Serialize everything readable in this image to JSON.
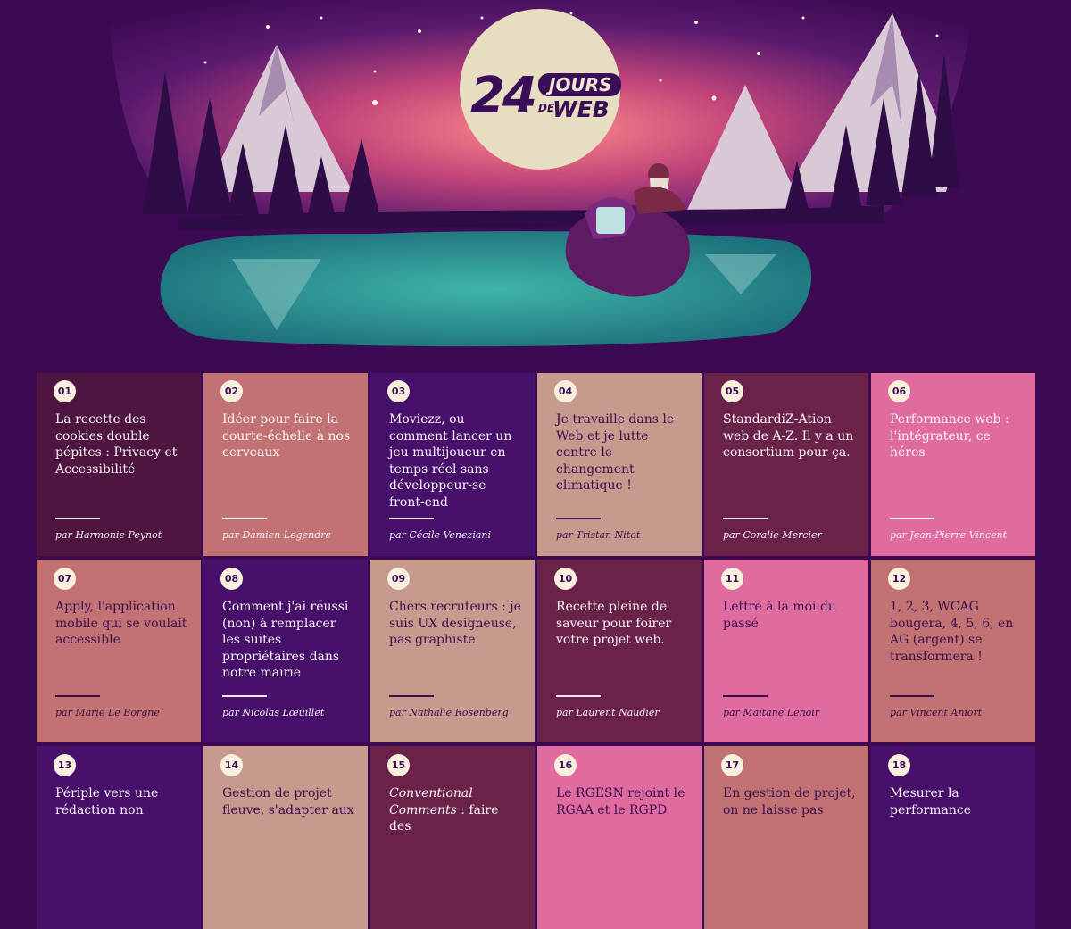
{
  "logo": {
    "number": "24",
    "jours": "JOURS",
    "de": "DE",
    "web": "WEB"
  },
  "cards": [
    {
      "num": "01",
      "title": "La recette des cookies double pépites : Privacy et Accessibilité",
      "author": "par Harmonie Peynot",
      "color": "#4e1540",
      "dark": false
    },
    {
      "num": "02",
      "title": "Idéer pour faire la courte-échelle à nos cerveaux",
      "author": "par Damien Legendre",
      "color": "#c27272",
      "dark": false
    },
    {
      "num": "03",
      "title": "Moviezz, ou comment lancer un jeu multijoueur en temps réel sans développeur-se front-end",
      "author": "par Cécile Veneziani",
      "color": "#46106b",
      "dark": false
    },
    {
      "num": "04",
      "title": "Je travaille dans le Web et je lutte contre le changement climatique !",
      "author": "par Tristan Nitot",
      "color": "#c79a8d",
      "dark": true
    },
    {
      "num": "05",
      "title": "StandardiZ-Ation web de A-Z. Il y a un consortium pour ça.",
      "author": "par Coralie Mercier",
      "color": "#6a2249",
      "dark": false
    },
    {
      "num": "06",
      "title": "Performance web : l'intégrateur, ce héros",
      "author": "par Jean-Pierre Vincent",
      "color": "#e06b9f",
      "dark": false
    },
    {
      "num": "07",
      "title": "Apply, l'application mobile qui se voulait accessible",
      "author": "par Marie Le Borgne",
      "color": "#c27272",
      "dark": true
    },
    {
      "num": "08",
      "title": "Comment j'ai réussi (non) à remplacer les suites propriétaires dans notre mairie",
      "author": "par Nicolas Lœuillet",
      "color": "#46106b",
      "dark": false
    },
    {
      "num": "09",
      "title": "Chers recruteurs : je suis UX designeuse, pas graphiste",
      "author": "par Nathalie Rosenberg",
      "color": "#c79a8d",
      "dark": true
    },
    {
      "num": "10",
      "title": "Recette pleine de saveur pour foirer votre projet web.",
      "author": "par Laurent Naudier",
      "color": "#6a2249",
      "dark": false
    },
    {
      "num": "11",
      "title": "Lettre à la moi du passé",
      "author": "par Maïtané Lenoir",
      "color": "#e06b9f",
      "dark": true
    },
    {
      "num": "12",
      "title": "1, 2, 3, WCAG bougera, 4, 5, 6, en AG (argent) se transformera !",
      "author": "par Vincent Aniort",
      "color": "#c27272",
      "dark": true
    },
    {
      "num": "13",
      "title": "Périple vers une rédaction non",
      "author": "",
      "color": "#46106b",
      "dark": false
    },
    {
      "num": "14",
      "title": "Gestion de projet fleuve, s'adapter aux",
      "author": "",
      "color": "#c79a8d",
      "dark": true
    },
    {
      "num": "15",
      "title": "Conventional Comments : faire des",
      "author": "",
      "color": "#6a2249",
      "dark": false
    },
    {
      "num": "16",
      "title": "Le RGESN rejoint le RGAA et le RGPD",
      "author": "",
      "color": "#e06b9f",
      "dark": true
    },
    {
      "num": "17",
      "title": "En gestion de projet, on ne laisse pas",
      "author": "",
      "color": "#c27272",
      "dark": true
    },
    {
      "num": "18",
      "title": "Mesurer la performance",
      "author": "",
      "color": "#46106b",
      "dark": false
    }
  ]
}
